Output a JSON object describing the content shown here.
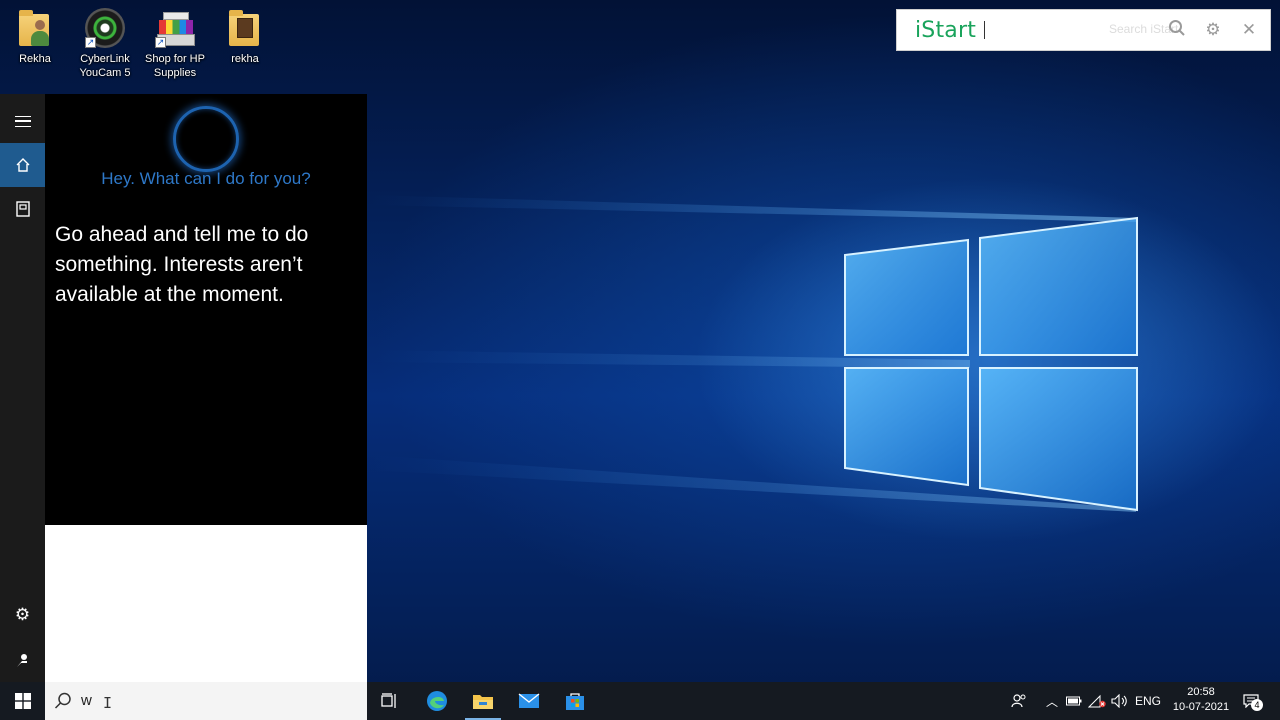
{
  "desktop": {
    "icons": [
      {
        "label": "Rekha",
        "icon": "user-folder-icon"
      },
      {
        "label": "CyberLink YouCam 5",
        "icon": "webcam-icon"
      },
      {
        "label": "Shop for HP Supplies",
        "icon": "printer-icon"
      },
      {
        "label": "rekha",
        "icon": "folder-icon"
      }
    ]
  },
  "istart": {
    "logo": "iStart",
    "ghost_text": "Search iStart"
  },
  "start_rail": {
    "items": [
      "menu-icon",
      "home-icon",
      "notebook-icon",
      "settings-icon",
      "feedback-icon"
    ]
  },
  "cortana": {
    "greeting": "Hey. What can I do for you?",
    "message": "Go ahead and tell me to do something. Interests aren’t available at the moment."
  },
  "taskbar": {
    "search_query": "w",
    "language": "ENG",
    "time": "20:58",
    "date": "10-07-2021",
    "notification_count": "4",
    "pinned": [
      "task-view-icon",
      "edge-icon",
      "file-explorer-icon",
      "mail-icon",
      "store-icon"
    ]
  },
  "colors": {
    "accent": "#1f5b8f",
    "cortana_blue": "#2e78c8",
    "istart_green": "#19a35b",
    "taskbar": "#151a21"
  }
}
